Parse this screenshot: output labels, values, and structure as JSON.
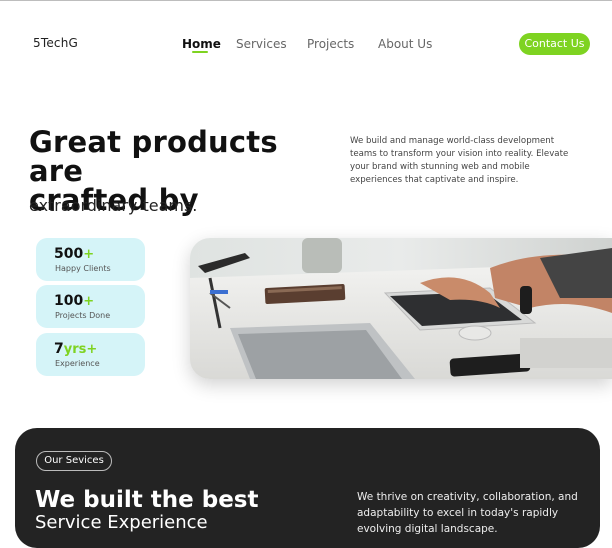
{
  "brand": {
    "logo": "5TechG",
    "accent": "#7ed321",
    "dark_bg": "#232323",
    "stat_bg": "#d5f4f8"
  },
  "nav": {
    "items": [
      {
        "label": "Home",
        "active": true
      },
      {
        "label": "Services",
        "active": false
      },
      {
        "label": "Projects",
        "active": false
      },
      {
        "label": "About Us",
        "active": false
      }
    ],
    "cta": "Contact Us"
  },
  "hero": {
    "title_line1": "Great products are",
    "title_line2": "crafted by",
    "subtitle": "extraordinary teams.",
    "description": "We build and manage world-class development teams to transform your vision into reality. Elevate your brand with stunning web and mobile experiences that captivate and inspire."
  },
  "stats": [
    {
      "value": "500",
      "suffix": "+",
      "label": "Happy Clients"
    },
    {
      "value": "100",
      "suffix": "+",
      "label": "Projects Done"
    },
    {
      "value": "7",
      "suffix": "yrs+",
      "label": "Experience"
    }
  ],
  "image": {
    "alt": "person-typing-on-laptop-photo"
  },
  "services": {
    "badge": "Our Sevices",
    "title_line1": "We built the best",
    "title_line2": "Service Experience",
    "description": "We thrive on creativity, collaboration, and adaptability to excel in today's rapidly evolving digital landscape."
  }
}
